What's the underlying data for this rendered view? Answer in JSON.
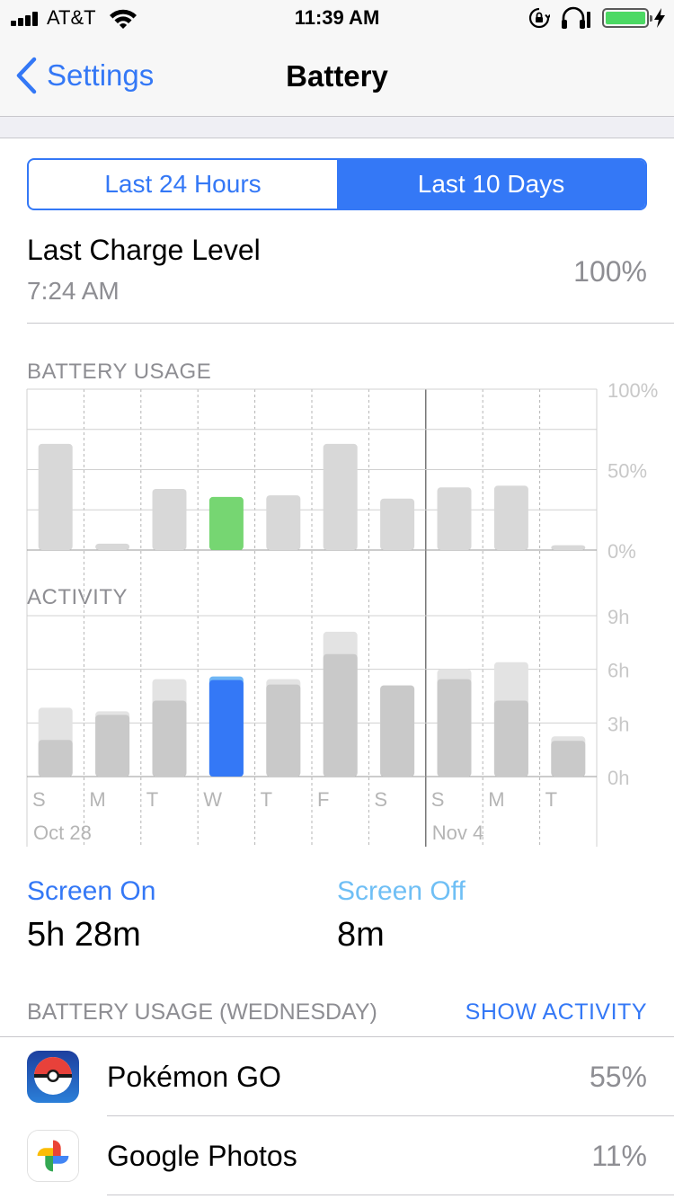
{
  "status_bar": {
    "carrier": "AT&T",
    "time": "11:39 AM",
    "signal_icon": "signal-bars-icon",
    "wifi_icon": "wifi-icon",
    "lock_icon": "orientation-lock-icon",
    "headphones_icon": "headphones-icon",
    "battery_level": 1.0,
    "battery_color": "#4cd964"
  },
  "nav": {
    "back_label": "Settings",
    "title": "Battery"
  },
  "segments": [
    {
      "label": "Last 24 Hours",
      "selected": false
    },
    {
      "label": "Last 10 Days",
      "selected": true
    }
  ],
  "last_charge": {
    "label": "Last Charge Level",
    "time": "7:24 AM",
    "value": "100%"
  },
  "battery_usage": {
    "header": "BATTERY USAGE",
    "y_ticks": [
      "100%",
      "50%",
      "0%"
    ]
  },
  "activity": {
    "header": "ACTIVITY",
    "y_ticks": [
      "9h",
      "6h",
      "3h",
      "0h"
    ]
  },
  "day_labels": [
    "S",
    "M",
    "T",
    "W",
    "T",
    "F",
    "S",
    "S",
    "M",
    "T"
  ],
  "date_labels": [
    {
      "text": "Oct 28",
      "index": 0
    },
    {
      "text": "Nov 4",
      "index": 7
    }
  ],
  "chart_data": [
    {
      "type": "bar",
      "title": "BATTERY USAGE",
      "categories": [
        "S",
        "M",
        "T",
        "W",
        "T",
        "F",
        "S",
        "S",
        "M",
        "T"
      ],
      "values": [
        66,
        4,
        38,
        33,
        34,
        66,
        32,
        39,
        40,
        3
      ],
      "ylim": [
        0,
        100
      ],
      "y_unit": "%",
      "highlight_index": 3,
      "colors": {
        "bar": "#d8d8d8",
        "highlight": "#76d672"
      },
      "grid": true
    },
    {
      "type": "bar",
      "title": "ACTIVITY",
      "categories": [
        "S",
        "M",
        "T",
        "W",
        "T",
        "F",
        "S",
        "S",
        "M",
        "T"
      ],
      "series": [
        {
          "values": [
            3.85,
            3.65,
            5.45,
            5.6,
            5.45,
            8.1,
            5.1,
            6.0,
            6.4,
            2.25
          ]
        },
        {
          "values": [
            2.05,
            3.45,
            4.25,
            5.4,
            5.15,
            6.85,
            5.1,
            5.45,
            4.25,
            2.0
          ]
        }
      ],
      "ylim": [
        0,
        9
      ],
      "y_unit": "h",
      "highlight_index": 3,
      "colors": {
        "total": "#e3e3e3",
        "screen_on": "#c9c9c9",
        "highlight": "#3478f6",
        "highlight_light": "#6fb6f5"
      },
      "grid": true
    }
  ],
  "screen_on": {
    "label": "Screen On",
    "value": "5h 28m",
    "color": "#3478f6"
  },
  "screen_off": {
    "label": "Screen Off",
    "value": "8m",
    "color": "#6fbff5"
  },
  "usage_section": {
    "header": "BATTERY USAGE (WEDNESDAY)",
    "action": "SHOW ACTIVITY"
  },
  "apps": [
    {
      "name": "Pokémon GO",
      "percent": "55%",
      "icon": "pokeball-icon"
    },
    {
      "name": "Google Photos",
      "percent": "11%",
      "icon": "google-photos-pinwheel-icon"
    }
  ]
}
